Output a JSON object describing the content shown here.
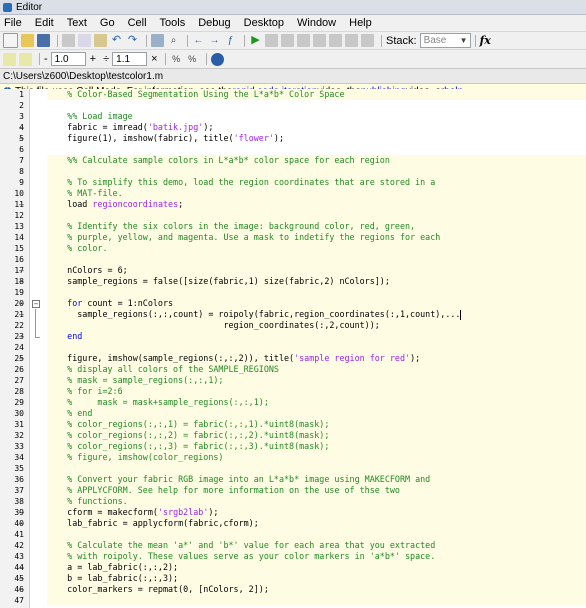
{
  "window": {
    "title": "Editor"
  },
  "menu": [
    "File",
    "Edit",
    "Text",
    "Go",
    "Cell",
    "Tools",
    "Debug",
    "Desktop",
    "Window",
    "Help"
  ],
  "toolbar": {
    "stack_label": "Stack:",
    "stack_value": "Base",
    "fx_label": "fx"
  },
  "toolbar2": {
    "minus": "-",
    "value1": "1.0",
    "plus": "+",
    "divide": "÷",
    "value2": "1.1",
    "times": "×"
  },
  "path": "C:\\Users\\z600\\Desktop\\testcolor1.m",
  "info": {
    "prefix": "This file uses Cell Mode. For information, see the ",
    "link1": "rapid code iteration",
    "middle1": " video, the ",
    "link2": "publishing",
    "middle2": " video, or ",
    "link3": "help",
    "suffix": "."
  },
  "code_lines": [
    {
      "n": "1",
      "m": "",
      "cell": true,
      "segs": [
        {
          "c": "cmt",
          "t": "    % Color-Based Segmentation Using the L*a*b* Color Space"
        }
      ]
    },
    {
      "n": "2",
      "m": "",
      "cell": false,
      "segs": []
    },
    {
      "n": "3",
      "m": "",
      "cell": false,
      "segs": [
        {
          "c": "cmt",
          "t": "    %% Load image"
        }
      ]
    },
    {
      "n": "4",
      "m": "–",
      "cell": false,
      "segs": [
        {
          "c": "",
          "t": "    fabric = imread("
        },
        {
          "c": "str",
          "t": "'batik.jpg'"
        },
        {
          "c": "",
          "t": ");"
        }
      ]
    },
    {
      "n": "5",
      "m": "–",
      "cell": false,
      "segs": [
        {
          "c": "",
          "t": "    figure(1), imshow(fabric), title("
        },
        {
          "c": "str",
          "t": "'flower'"
        },
        {
          "c": "",
          "t": ");"
        }
      ]
    },
    {
      "n": "6",
      "m": "",
      "cell": false,
      "segs": []
    },
    {
      "n": "7",
      "m": "",
      "cell": true,
      "segs": [
        {
          "c": "cmt",
          "t": "    %% Calculate sample colors in L*a*b* color space for each region"
        }
      ]
    },
    {
      "n": "8",
      "m": "",
      "cell": true,
      "segs": []
    },
    {
      "n": "9",
      "m": "",
      "cell": true,
      "segs": [
        {
          "c": "cmt",
          "t": "    % To simplify this demo, load the region coordinates that are stored in a"
        }
      ]
    },
    {
      "n": "10",
      "m": "",
      "cell": true,
      "segs": [
        {
          "c": "cmt",
          "t": "    % MAT-file."
        }
      ]
    },
    {
      "n": "11",
      "m": "–",
      "cell": true,
      "segs": [
        {
          "c": "",
          "t": "    load "
        },
        {
          "c": "str",
          "t": "regioncoordinates"
        },
        {
          "c": "",
          "t": ";"
        }
      ]
    },
    {
      "n": "12",
      "m": "",
      "cell": true,
      "segs": []
    },
    {
      "n": "13",
      "m": "",
      "cell": true,
      "segs": [
        {
          "c": "cmt",
          "t": "    % Identify the six colors in the image: background color, red, green,"
        }
      ]
    },
    {
      "n": "14",
      "m": "",
      "cell": true,
      "segs": [
        {
          "c": "cmt",
          "t": "    % purple, yellow, and magenta. Use a mask to indetify the regions for each"
        }
      ]
    },
    {
      "n": "15",
      "m": "",
      "cell": true,
      "segs": [
        {
          "c": "cmt",
          "t": "    % color."
        }
      ]
    },
    {
      "n": "16",
      "m": "",
      "cell": true,
      "segs": []
    },
    {
      "n": "17",
      "m": "–",
      "cell": true,
      "segs": [
        {
          "c": "",
          "t": "    nColors = 6;"
        }
      ]
    },
    {
      "n": "18",
      "m": "–",
      "cell": true,
      "segs": [
        {
          "c": "",
          "t": "    sample_regions = false([size(fabric,1) size(fabric,2) nColors]);"
        }
      ]
    },
    {
      "n": "19",
      "m": "",
      "cell": true,
      "segs": []
    },
    {
      "n": "20",
      "m": "–",
      "cell": true,
      "fold": "start",
      "segs": [
        {
          "c": "kw",
          "t": "    for"
        },
        {
          "c": "",
          "t": " count = 1:nColors"
        }
      ]
    },
    {
      "n": "21",
      "m": "–",
      "cell": true,
      "fold": "mid",
      "segs": [
        {
          "c": "",
          "t": "      sample_regions(:,:,count) = roipoly(fabric,region_coordinates(:,1,count),..."
        }
      ],
      "cursor": true
    },
    {
      "n": "22",
      "m": "",
      "cell": true,
      "fold": "mid",
      "segs": [
        {
          "c": "",
          "t": "                                   region_coordinates(:,2,count));"
        }
      ]
    },
    {
      "n": "23",
      "m": "–",
      "cell": true,
      "fold": "end",
      "segs": [
        {
          "c": "kw",
          "t": "    end"
        }
      ]
    },
    {
      "n": "24",
      "m": "",
      "cell": true,
      "segs": []
    },
    {
      "n": "25",
      "m": "–",
      "cell": true,
      "segs": [
        {
          "c": "",
          "t": "    figure, imshow(sample_regions(:,:,2)), title("
        },
        {
          "c": "str",
          "t": "'sample region for red'"
        },
        {
          "c": "",
          "t": ");"
        }
      ]
    },
    {
      "n": "26",
      "m": "",
      "cell": true,
      "segs": [
        {
          "c": "cmt",
          "t": "    % display all colors of the SAMPLE_REGIONS"
        }
      ]
    },
    {
      "n": "27",
      "m": "",
      "cell": true,
      "segs": [
        {
          "c": "cmt",
          "t": "    % mask = sample_regions(:,:,1);"
        }
      ]
    },
    {
      "n": "28",
      "m": "",
      "cell": true,
      "segs": [
        {
          "c": "cmt",
          "t": "    % for i=2:6"
        }
      ]
    },
    {
      "n": "29",
      "m": "",
      "cell": true,
      "segs": [
        {
          "c": "cmt",
          "t": "    %     mask = mask+sample_regions(:,:,1);"
        }
      ]
    },
    {
      "n": "30",
      "m": "",
      "cell": true,
      "segs": [
        {
          "c": "cmt",
          "t": "    % end"
        }
      ]
    },
    {
      "n": "31",
      "m": "",
      "cell": true,
      "segs": [
        {
          "c": "cmt",
          "t": "    % color_regions(:,:,1) = fabric(:,:,1).*uint8(mask);"
        }
      ]
    },
    {
      "n": "32",
      "m": "",
      "cell": true,
      "segs": [
        {
          "c": "cmt",
          "t": "    % color_regions(:,:,2) = fabric(:,:,2).*uint8(mask);"
        }
      ]
    },
    {
      "n": "33",
      "m": "",
      "cell": true,
      "segs": [
        {
          "c": "cmt",
          "t": "    % color_regions(:,:,3) = fabric(:,:,3).*uint8(mask);"
        }
      ]
    },
    {
      "n": "34",
      "m": "",
      "cell": true,
      "segs": [
        {
          "c": "cmt",
          "t": "    % figure, imshow(color_regions)"
        }
      ]
    },
    {
      "n": "35",
      "m": "",
      "cell": true,
      "segs": []
    },
    {
      "n": "36",
      "m": "",
      "cell": true,
      "segs": [
        {
          "c": "cmt",
          "t": "    % Convert your fabric RGB image into an L*a*b* image using MAKECFORM and"
        }
      ]
    },
    {
      "n": "37",
      "m": "",
      "cell": true,
      "segs": [
        {
          "c": "cmt",
          "t": "    % APPLYCFORM. See help for more information on the use of thse two"
        }
      ]
    },
    {
      "n": "38",
      "m": "",
      "cell": true,
      "segs": [
        {
          "c": "cmt",
          "t": "    % functions."
        }
      ]
    },
    {
      "n": "39",
      "m": "–",
      "cell": true,
      "segs": [
        {
          "c": "",
          "t": "    cform = makecform("
        },
        {
          "c": "str",
          "t": "'srgb2lab'"
        },
        {
          "c": "",
          "t": ");"
        }
      ]
    },
    {
      "n": "40",
      "m": "–",
      "cell": true,
      "segs": [
        {
          "c": "",
          "t": "    lab_fabric = applycform(fabric,cform);"
        }
      ]
    },
    {
      "n": "41",
      "m": "",
      "cell": true,
      "segs": []
    },
    {
      "n": "42",
      "m": "",
      "cell": true,
      "segs": [
        {
          "c": "cmt",
          "t": "    % Calculate the mean 'a*' and 'b*' value for each area that you extracted"
        }
      ]
    },
    {
      "n": "43",
      "m": "",
      "cell": true,
      "segs": [
        {
          "c": "cmt",
          "t": "    % with roipoly. These values serve as your color markers in 'a*b*' space."
        }
      ]
    },
    {
      "n": "44",
      "m": "–",
      "cell": true,
      "segs": [
        {
          "c": "",
          "t": "    a = lab_fabric(:,:,2);"
        }
      ]
    },
    {
      "n": "45",
      "m": "–",
      "cell": true,
      "segs": [
        {
          "c": "",
          "t": "    b = lab_fabric(:,:,3);"
        }
      ]
    },
    {
      "n": "46",
      "m": "–",
      "cell": true,
      "segs": [
        {
          "c": "",
          "t": "    color_markers = repmat(0, [nColors, 2]);"
        }
      ]
    },
    {
      "n": "47",
      "m": "",
      "cell": true,
      "segs": []
    }
  ]
}
